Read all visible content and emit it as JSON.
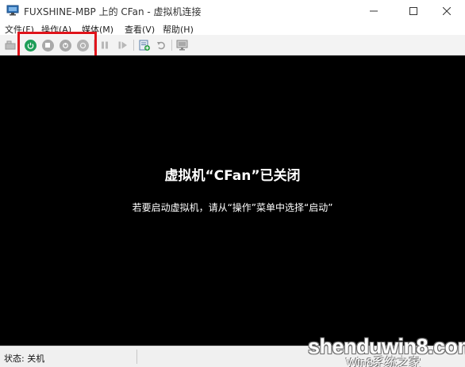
{
  "window": {
    "title": "FUXSHINE-MBP 上的 CFan - 虚拟机连接",
    "min_label": "—",
    "max_label": "☐",
    "close_label": "✕"
  },
  "menu": {
    "items": [
      "文件(F)",
      "操作(A)",
      "媒体(M)",
      "查看(V)",
      "帮助(H)"
    ]
  },
  "toolbar": {
    "buttons": [
      {
        "name": "ctrl-alt-del-icon"
      },
      {
        "name": "start-icon",
        "color": "#1e9e58"
      },
      {
        "name": "turn-off-icon",
        "color": "#a0a0a0"
      },
      {
        "name": "shutdown-icon",
        "color": "#a0a0a0"
      },
      {
        "name": "save-icon",
        "color": "#a0a0a0"
      },
      {
        "name": "pause-icon"
      },
      {
        "name": "resume-icon"
      },
      {
        "name": "checkpoint-icon"
      },
      {
        "name": "revert-icon"
      },
      {
        "name": "enhanced-session-icon"
      }
    ],
    "highlight_color": "#e0141b"
  },
  "screen": {
    "title": "虚拟机“CFan”已关闭",
    "message": "若要启动虚拟机，请从“操作”菜单中选择“启动”",
    "background": "#000000"
  },
  "status": {
    "text": "状态: 关机"
  },
  "watermark": {
    "main": "shenduwin8.com",
    "sub": "Win8系统之家"
  }
}
